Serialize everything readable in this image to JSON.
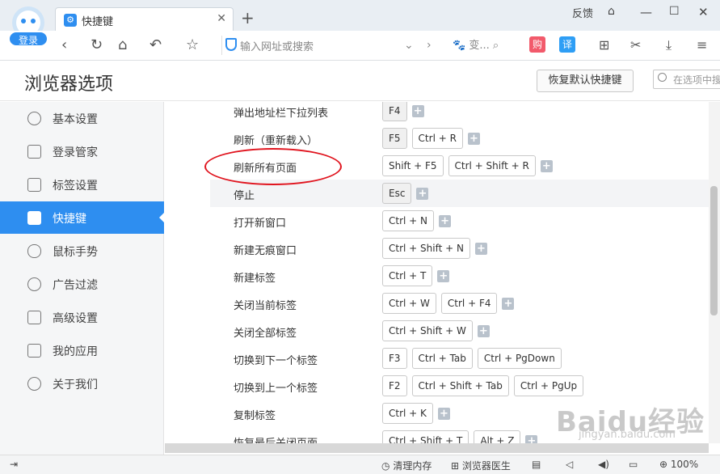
{
  "titlebar": {
    "login": "登录",
    "tab_title": "快捷键",
    "feedback": "反馈"
  },
  "toolbar": {
    "address_placeholder": "输入网址或搜索",
    "search_text": "变...",
    "shop_label": "购",
    "translate_label": "译"
  },
  "header": {
    "title": "浏览器选项",
    "restore_button": "恢复默认快捷键",
    "search_placeholder": "在选项中搜"
  },
  "sidebar": {
    "items": [
      {
        "label": "基本设置",
        "icon": "gear-icon"
      },
      {
        "label": "登录管家",
        "icon": "lock-icon"
      },
      {
        "label": "标签设置",
        "icon": "tabs-icon"
      },
      {
        "label": "快捷键",
        "icon": "shortcut-icon"
      },
      {
        "label": "鼠标手势",
        "icon": "mouse-icon"
      },
      {
        "label": "广告过滤",
        "icon": "block-icon"
      },
      {
        "label": "高级设置",
        "icon": "wrench-icon"
      },
      {
        "label": "我的应用",
        "icon": "apps-icon"
      },
      {
        "label": "关于我们",
        "icon": "info-icon"
      }
    ],
    "active": "快捷键"
  },
  "shortcuts": [
    {
      "name": "弹出地址栏下拉列表",
      "keys": [
        "F4"
      ]
    },
    {
      "name": "刷新（重新载入）",
      "keys": [
        "F5",
        "Ctrl + R"
      ]
    },
    {
      "name": "刷新所有页面",
      "keys": [
        "Shift + F5",
        "Ctrl + Shift + R"
      ]
    },
    {
      "name": "停止",
      "keys": [
        "Esc"
      ]
    },
    {
      "name": "打开新窗口",
      "keys": [
        "Ctrl + N"
      ]
    },
    {
      "name": "新建无痕窗口",
      "keys": [
        "Ctrl + Shift + N"
      ]
    },
    {
      "name": "新建标签",
      "keys": [
        "Ctrl + T"
      ]
    },
    {
      "name": "关闭当前标签",
      "keys": [
        "Ctrl + W",
        "Ctrl + F4"
      ]
    },
    {
      "name": "关闭全部标签",
      "keys": [
        "Ctrl + Shift + W"
      ]
    },
    {
      "name": "切换到下一个标签",
      "keys": [
        "F3",
        "Ctrl + Tab",
        "Ctrl + PgDown"
      ]
    },
    {
      "name": "切换到上一个标签",
      "keys": [
        "F2",
        "Ctrl + Shift + Tab",
        "Ctrl + PgUp"
      ]
    },
    {
      "name": "复制标签",
      "keys": [
        "Ctrl + K"
      ]
    },
    {
      "name": "恢复最后关闭页面",
      "keys": [
        "Ctrl + Shift + T",
        "Alt + Z"
      ]
    }
  ],
  "statusbar": {
    "clean_memory": "清理内存",
    "browser_doctor": "浏览器医生",
    "zoom": "100%"
  },
  "watermark": {
    "brand": "Baidu经验",
    "url": "jingyan.baidu.com"
  }
}
